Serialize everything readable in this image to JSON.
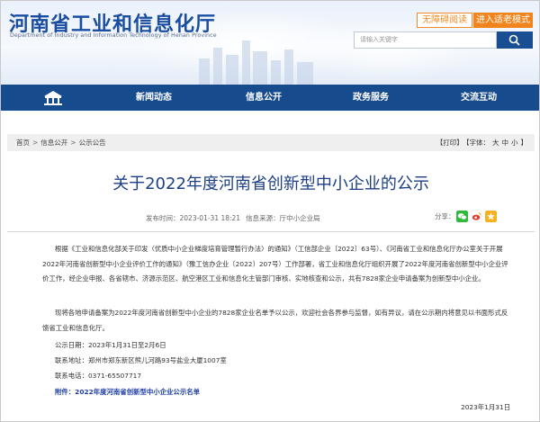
{
  "header": {
    "site_title": "河南省工业和信息化厅",
    "site_subtitle": "Department of Industry and Information Technology of Henan Province",
    "accessibility_label": "无障碍阅读",
    "elder_mode_label": "进入适老模式",
    "search_placeholder": "请输入关键字"
  },
  "nav": {
    "items": [
      {
        "label": "新闻动态"
      },
      {
        "label": "信息公开"
      },
      {
        "label": "政务服务"
      },
      {
        "label": "交流互动"
      }
    ]
  },
  "breadcrumb": {
    "items": [
      "首页",
      "信息公开",
      "公示公告"
    ],
    "separator": ">",
    "print_label": "【打印】",
    "font_label": "【字体：",
    "font_large": "大",
    "font_medium": "中",
    "font_small": "小",
    "font_close": "】"
  },
  "article": {
    "title": "关于2022年度河南省创新型中小企业的公示",
    "publish_time": "发布时间：2023-01-31 18:21",
    "source": "信息来源：厅中小企业局",
    "share_label": "分享：",
    "paragraph1": "根据《工业和信息化部关于印发〈优质中小企业梯度培育管理暂行办法〉的通知》（工信部企业〔2022〕63号）、《河南省工业和信息化厅办公室关于开展2022年河南省创新型中小企业评价工作的通知》（豫工信办企业〔2022〕207号）工作部署，省工业和信息化厅组织开展了2022年度河南省创新型中小企业评价工作，经企业申报、各省辖市、济源示范区、航空港区工业和信息化主管部门审核、实地核查和公示，共有7828家企业申请备案为创新型中小企业。",
    "paragraph2": "现将各地申请备案为2022年度河南省创新型中小企业的7828家企业名单予以公示，欢迎社会各界参与监督，如有异议，请在公示期内将意见以书面形式反馈省工业和信息化厅。",
    "period": "公示日期：2023年1月31日至2月6日",
    "address": "联系地址：郑州市郑东新区熊儿河路93号盐业大厦1007室",
    "phone": "联系电话：0371-65507717",
    "attachment": "附件：2022年度河南省创新型中小企业公示名单",
    "date": "2023年1月31日"
  },
  "colors": {
    "brand_blue": "#164c8e",
    "title_blue": "#1c3f85",
    "orange": "#f2841e",
    "wechat_green": "#2dbb38",
    "weibo_red": "#e63a2e",
    "favorite_yellow": "#f5b21c"
  },
  "icons": [
    "home-icon",
    "search-icon",
    "wechat-icon",
    "weibo-icon",
    "star-icon"
  ]
}
